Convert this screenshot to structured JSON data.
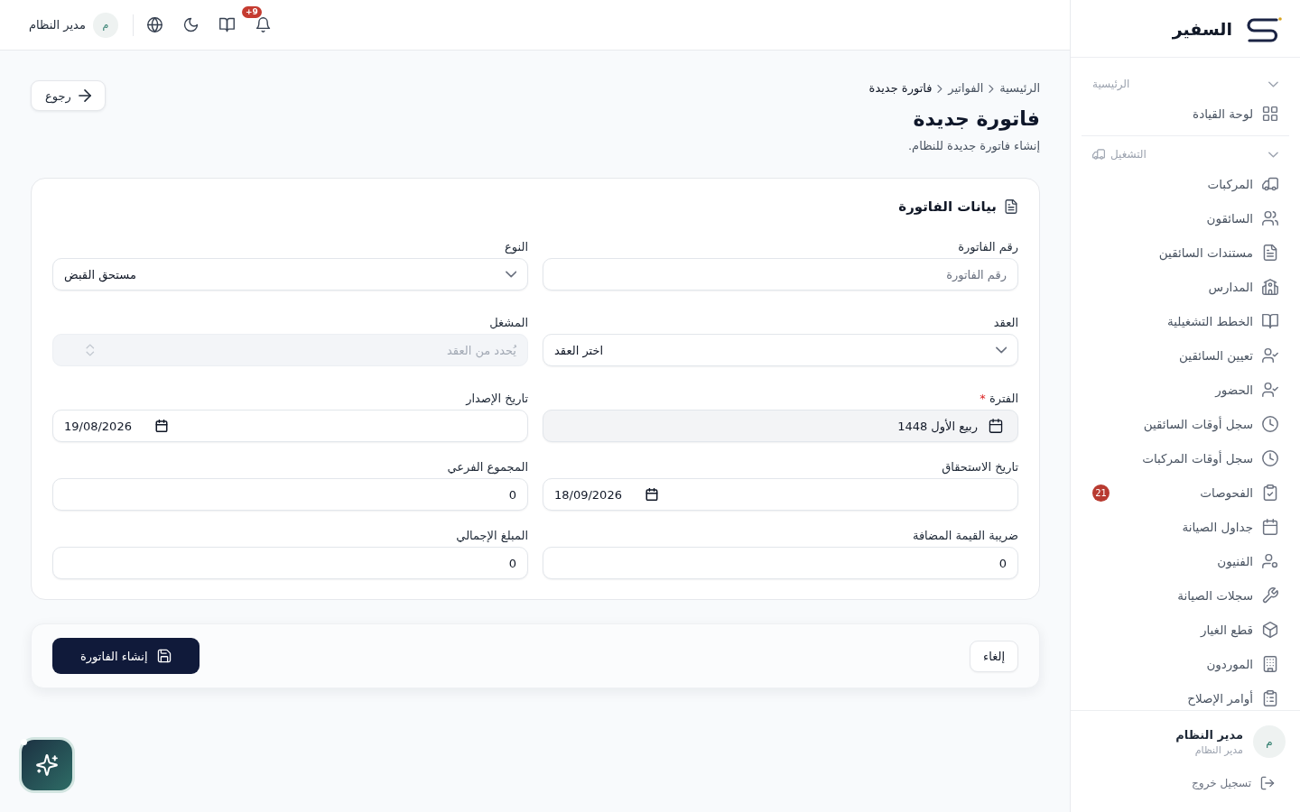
{
  "sidebar": {
    "brand": "السفير",
    "sections": [
      {
        "title": "الرئيسية",
        "expanded": true,
        "items": [
          {
            "label": "لوحة القيادة",
            "selected": false
          }
        ]
      },
      {
        "title": "التشغيل",
        "expanded": true,
        "items": [
          {
            "label": "المركبات",
            "selected": false
          },
          {
            "label": "السائقون",
            "selected": false
          },
          {
            "label": "مستندات السائقين",
            "selected": false
          },
          {
            "label": "المدارس",
            "selected": false
          },
          {
            "label": "الخطط التشغيلية",
            "selected": false
          },
          {
            "label": "تعيين السائقين",
            "selected": false
          },
          {
            "label": "الحضور",
            "selected": false
          },
          {
            "label": "سجل أوقات السائقين",
            "selected": false
          },
          {
            "label": "سجل أوقات المركبات",
            "selected": false
          },
          {
            "label": "الفحوصات",
            "selected": false,
            "badge": "21"
          },
          {
            "label": "جداول الصيانة",
            "selected": false
          },
          {
            "label": "الفنيون",
            "selected": false
          },
          {
            "label": "سجلات الصيانة",
            "selected": false
          },
          {
            "label": "قطع الغيار",
            "selected": false
          },
          {
            "label": "الموردون",
            "selected": false
          },
          {
            "label": "أوامر الإصلاح",
            "selected": false
          }
        ]
      }
    ],
    "user": {
      "initial": "م",
      "name": "مدير النظام",
      "role": "مدير النظام"
    },
    "logout": "تسجيل خروج"
  },
  "topbar": {
    "notification_badge": "+9",
    "user": {
      "initial": "م",
      "name": "مدير النظام"
    }
  },
  "breadcrumb": [
    {
      "label": "الرئيسية",
      "current": false
    },
    {
      "label": "الفواتير",
      "current": false
    },
    {
      "label": "فاتورة جديدة",
      "current": true
    }
  ],
  "header": {
    "title": "فاتورة جديدة",
    "subtitle": "إنشاء فاتورة جديدة للنظام.",
    "back_button": "رجوع"
  },
  "form": {
    "title": "بيانات الفاتورة",
    "fields": [
      {
        "kind": "text",
        "label": "رقم الفاتورة",
        "placeholder": "رقم الفاتورة",
        "disabled": false
      },
      {
        "kind": "select",
        "label": "النوع",
        "value": "مستحق القبض",
        "disabled": false
      },
      {
        "kind": "select",
        "label": "العقد",
        "value": "اختر العقد",
        "disabled": false
      },
      {
        "kind": "combobox",
        "label": "المشغل",
        "placeholder": "يُحدد من العقد",
        "disabled": true
      },
      {
        "kind": "picker",
        "label": "الفترة",
        "required_mark": "*",
        "value": "ربيع الأول 1448",
        "disabled": false
      },
      {
        "kind": "date",
        "label": "تاريخ الإصدار",
        "value": "19/08/2026",
        "disabled": false
      },
      {
        "kind": "date",
        "label": "تاريخ الاستحقاق",
        "value": "18/09/2026",
        "disabled": false
      },
      {
        "kind": "number",
        "label": "المجموع الفرعي",
        "value": "0",
        "disabled": false
      },
      {
        "kind": "number",
        "label": "ضريبة القيمة المضافة",
        "value": "0",
        "disabled": false
      },
      {
        "kind": "number",
        "label": "المبلغ الإجمالي",
        "value": "0",
        "disabled": false
      }
    ]
  },
  "actions": {
    "cancel": "إلغاء",
    "submit": "إنشاء الفاتورة"
  }
}
